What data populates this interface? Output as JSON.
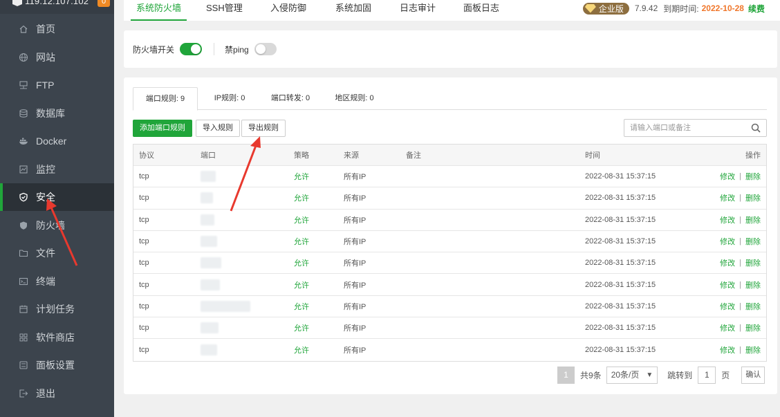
{
  "sidebar": {
    "host": "119.12.107.102",
    "badge": "0",
    "items": [
      {
        "label": "首页",
        "icon": "home-icon"
      },
      {
        "label": "网站",
        "icon": "globe-icon"
      },
      {
        "label": "FTP",
        "icon": "ftp-icon"
      },
      {
        "label": "数据库",
        "icon": "database-icon"
      },
      {
        "label": "Docker",
        "icon": "docker-icon"
      },
      {
        "label": "监控",
        "icon": "monitor-icon"
      },
      {
        "label": "安全",
        "icon": "shield-check-icon",
        "active": true
      },
      {
        "label": "防火墙",
        "icon": "shield-icon"
      },
      {
        "label": "文件",
        "icon": "folder-icon"
      },
      {
        "label": "终端",
        "icon": "terminal-icon"
      },
      {
        "label": "计划任务",
        "icon": "calendar-icon"
      },
      {
        "label": "软件商店",
        "icon": "grid-icon"
      },
      {
        "label": "面板设置",
        "icon": "settings-icon"
      },
      {
        "label": "退出",
        "icon": "logout-icon"
      }
    ]
  },
  "top_tabs": [
    "系统防火墙",
    "SSH管理",
    "入侵防御",
    "系统加固",
    "日志审计",
    "面板日志"
  ],
  "top_right": {
    "edition": "企业版",
    "version": "7.9.42",
    "expire_label": "到期时间:",
    "expire_date": "2022-10-28",
    "renew": "续费"
  },
  "switches": {
    "firewall_label": "防火墙开关",
    "firewall_on": true,
    "ping_label": "禁ping",
    "ping_on": false
  },
  "sub_tabs": [
    "端口规则: 9",
    "IP规则: 0",
    "端口转发: 0",
    "地区规则: 0"
  ],
  "buttons": {
    "add": "添加端口规则",
    "import": "导入规则",
    "export": "导出规则"
  },
  "search": {
    "placeholder": "请输入端口或备注",
    "value": ""
  },
  "table": {
    "headers": [
      "协议",
      "端口",
      "策略",
      "来源",
      "备注",
      "时间",
      "操作"
    ],
    "rows": [
      {
        "proto": "tcp",
        "policy": "允许",
        "source": "所有IP",
        "note": "",
        "time": "2022-08-31 15:37:15"
      },
      {
        "proto": "tcp",
        "policy": "允许",
        "source": "所有IP",
        "note": "",
        "time": "2022-08-31 15:37:15"
      },
      {
        "proto": "tcp",
        "policy": "允许",
        "source": "所有IP",
        "note": "",
        "time": "2022-08-31 15:37:15"
      },
      {
        "proto": "tcp",
        "policy": "允许",
        "source": "所有IP",
        "note": "",
        "time": "2022-08-31 15:37:15"
      },
      {
        "proto": "tcp",
        "policy": "允许",
        "source": "所有IP",
        "note": "",
        "time": "2022-08-31 15:37:15"
      },
      {
        "proto": "tcp",
        "policy": "允许",
        "source": "所有IP",
        "note": "",
        "time": "2022-08-31 15:37:15"
      },
      {
        "proto": "tcp",
        "policy": "允许",
        "source": "所有IP",
        "note": "",
        "time": "2022-08-31 15:37:15"
      },
      {
        "proto": "tcp",
        "policy": "允许",
        "source": "所有IP",
        "note": "",
        "time": "2022-08-31 15:37:15"
      },
      {
        "proto": "tcp",
        "policy": "允许",
        "source": "所有IP",
        "note": "",
        "time": "2022-08-31 15:37:15"
      }
    ],
    "op_edit": "修改",
    "op_sep": "|",
    "op_delete": "删除"
  },
  "pager": {
    "current": "1",
    "total": "共9条",
    "size": "20条/页",
    "jump_label": "跳转到",
    "jump_value": "1",
    "page_unit": "页",
    "confirm": "确认"
  },
  "colors": {
    "accent": "#20a53a",
    "sidebar": "#3c444d",
    "warn": "#f0762a",
    "annotation": "#e8392e"
  }
}
